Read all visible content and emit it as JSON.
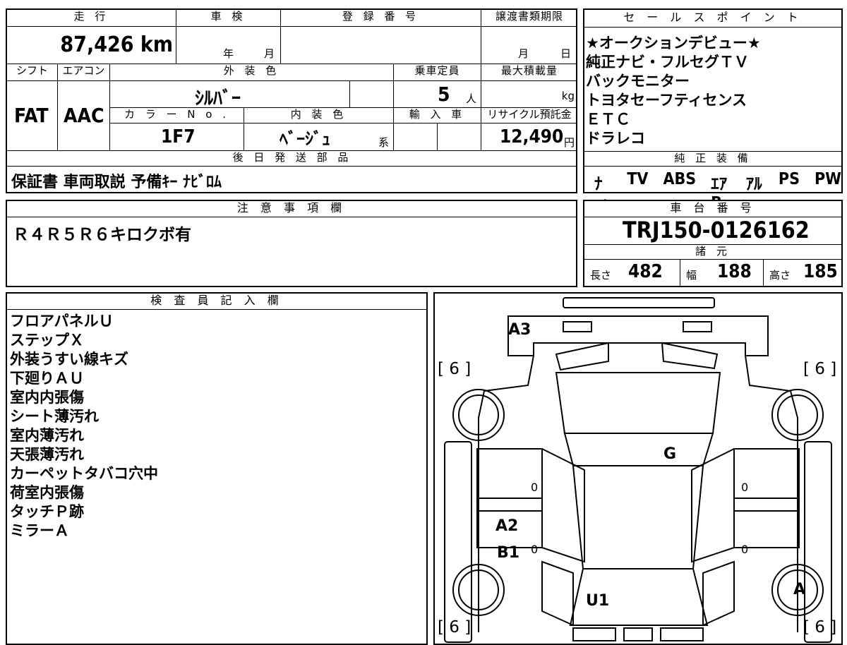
{
  "top": {
    "mileage_label": "走 行",
    "mileage": "87,426 km",
    "shaken_label": "車 検",
    "shaken_year": "年",
    "shaken_month": "月",
    "reg_label": "登 録 番 号",
    "transfer_label": "譲渡書類期限",
    "transfer_month": "月",
    "transfer_day": "日",
    "shift_label": "シフト",
    "shift": "FAT",
    "ac_label": "エアコン",
    "ac": "AAC",
    "ext_color_label": "外 装 色",
    "ext_color": "ｼﾙﾊﾞｰ",
    "capacity_label": "乗車定員",
    "capacity": "5",
    "capacity_unit": "人",
    "max_load_label": "最大積載量",
    "max_load_unit": "kg",
    "color_no_label": "カ ラ ー N o .",
    "color_no": "1F7",
    "int_color_label": "内 装 色",
    "int_color": "ﾍﾞｰｼﾞｭ",
    "int_color_suffix": "系",
    "import_label": "輸 入 車",
    "recycle_label": "リサイクル預託金",
    "recycle": "12,490",
    "recycle_unit": "円",
    "later_parts_label": "後 日 発 送 部 品",
    "later_parts": "保証書 車両取説 予備ｷｰ ﾅﾋﾞﾛﾑ"
  },
  "sales": {
    "label": "セ ー ル ス ポ イ ン ト",
    "points": [
      "★オークションデビュー★",
      "純正ナビ・フルセグＴＶ",
      "バックモニター",
      "トヨタセーフティセンス",
      "ＥＴＣ",
      "ドラレコ"
    ],
    "equipment_label": "純 正 装 備",
    "equipment": [
      "ﾅﾋﾞ",
      "TV",
      "ABS",
      "ｴｱB",
      "ｱﾙﾐ",
      "PS",
      "PW"
    ]
  },
  "notes": {
    "label": "注 意 事 項 欄",
    "text": "Ｒ４Ｒ５Ｒ６キロクボ有"
  },
  "chassis": {
    "label": "車 台 番 号",
    "number": "TRJ150-0126162",
    "specs_label": "諸 元",
    "length_label": "長さ",
    "length": "482",
    "width_label": "幅",
    "width": "188",
    "height_label": "高さ",
    "height": "185"
  },
  "inspector": {
    "label": "検 査 員 記 入 欄",
    "items": [
      "フロアパネルＵ",
      "ステップＸ",
      "外装うすい線キズ",
      "下廻りＡＵ",
      "室内内張傷",
      "シート薄汚れ",
      "室内薄汚れ",
      "天張薄汚れ",
      "カーペットタバコ穴中",
      "荷室内張傷",
      "タッチＰ跡",
      "ミラーＡ"
    ]
  },
  "diagram": {
    "tire_tl": "[ 6 ]",
    "tire_tr": "[ 6 ]",
    "tire_bl": "[ 6 ]",
    "tire_br": "[ 6 ]",
    "mark_a3": "A3",
    "mark_g": "G",
    "mark_a2": "A2",
    "mark_b1": "B1",
    "mark_u1": "U1",
    "mark_a": "A",
    "zero_l1": "0",
    "zero_l2": "0",
    "zero_r1": "0",
    "zero_r2": "0"
  }
}
